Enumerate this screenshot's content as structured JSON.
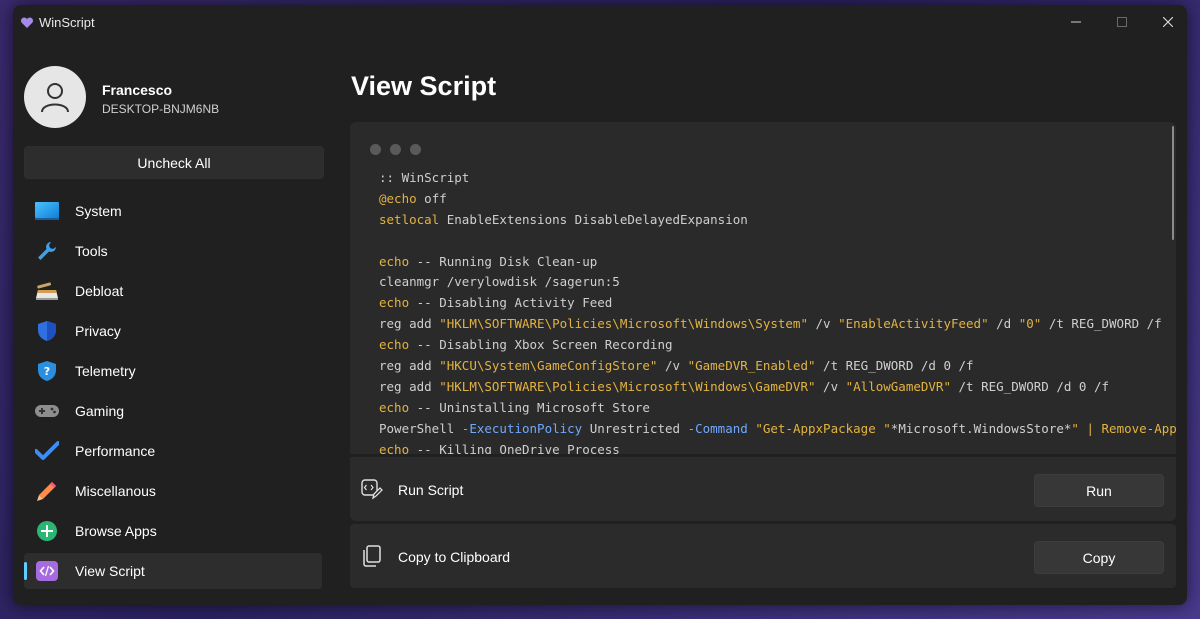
{
  "window": {
    "title": "WinScript"
  },
  "user": {
    "name": "Francesco",
    "machine": "DESKTOP-BNJM6NB"
  },
  "sidebar": {
    "uncheck_all": "Uncheck All",
    "items": [
      {
        "label": "System",
        "icon": "monitor-icon"
      },
      {
        "label": "Tools",
        "icon": "wrench-icon"
      },
      {
        "label": "Debloat",
        "icon": "broom-icon"
      },
      {
        "label": "Privacy",
        "icon": "shield-icon"
      },
      {
        "label": "Telemetry",
        "icon": "question-shield-icon"
      },
      {
        "label": "Gaming",
        "icon": "gamepad-icon"
      },
      {
        "label": "Performance",
        "icon": "checkmark-icon"
      },
      {
        "label": "Miscellanous",
        "icon": "pencil-icon"
      },
      {
        "label": "Browse Apps",
        "icon": "plus-circle-icon"
      },
      {
        "label": "View Script",
        "icon": "code-icon",
        "active": true
      }
    ]
  },
  "main": {
    "title": "View Script",
    "code_lines": [
      ":: WinScript",
      "@echo off",
      "setlocal EnableExtensions DisableDelayedExpansion",
      "",
      "echo -- Running Disk Clean-up",
      "cleanmgr /verylowdisk /sagerun:5",
      "echo -- Disabling Activity Feed",
      "reg add \"HKLM\\SOFTWARE\\Policies\\Microsoft\\Windows\\System\" /v \"EnableActivityFeed\" /d \"0\" /t REG_DWORD /f",
      "echo -- Disabling Xbox Screen Recording",
      "reg add \"HKCU\\System\\GameConfigStore\" /v \"GameDVR_Enabled\" /t REG_DWORD /d 0 /f",
      "reg add \"HKLM\\SOFTWARE\\Policies\\Microsoft\\Windows\\GameDVR\" /v \"AllowGameDVR\" /t REG_DWORD /d 0 /f",
      "echo -- Uninstalling Microsoft Store",
      "PowerShell -ExecutionPolicy Unrestricted -Command \"Get-AppxPackage \"*Microsoft.WindowsStore*\" | Remove-AppxPackage\"",
      "echo -- Killing OneDrive Process"
    ],
    "run": {
      "label": "Run Script",
      "button": "Run"
    },
    "copy": {
      "label": "Copy to Clipboard",
      "button": "Copy"
    }
  },
  "colors": {
    "accent": "#60cdff",
    "keyword": "#e3b341",
    "parameter": "#6fa8ff"
  }
}
